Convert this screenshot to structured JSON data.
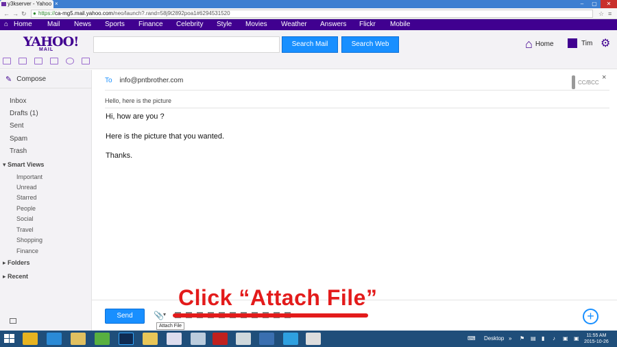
{
  "browser": {
    "tab_title": "y3kserver - Yahoo M",
    "url_prefix": "https://",
    "url_host": "ca-mg5.mail.yahoo.com",
    "url_path": "/neo/launch?.rand=58j9t2892poa1#6294531520"
  },
  "yahoo_nav": {
    "items": [
      "Home",
      "Mail",
      "News",
      "Sports",
      "Finance",
      "Celebrity",
      "Style",
      "Movies",
      "Weather",
      "Answers",
      "Flickr",
      "Mobile"
    ]
  },
  "header": {
    "logo": "YAHOO!",
    "logo_sub": "MAIL",
    "search_placeholder": "",
    "search_mail_label": "Search Mail",
    "search_web_label": "Search Web",
    "home_label": "Home",
    "user_label": "Tim"
  },
  "sidebar": {
    "compose_label": "Compose",
    "folders": [
      "Inbox",
      "Drafts (1)",
      "Sent",
      "Spam",
      "Trash"
    ],
    "smart_views_label": "Smart Views",
    "smart_views": [
      "Important",
      "Unread",
      "Starred",
      "People",
      "Social",
      "Travel",
      "Shopping",
      "Finance"
    ],
    "folders_label": "Folders",
    "recent_label": "Recent"
  },
  "compose": {
    "to_label": "To",
    "to_value": "info@pntbrother.com",
    "cc_label": "CC/BCC",
    "close_label": "×",
    "subject": "Hello, here is the picture",
    "body": [
      "Hi, how are you ?",
      "Here is the picture that you wanted.",
      "Thanks."
    ],
    "send_label": "Send",
    "attach_tooltip": "Attach File"
  },
  "annotation": {
    "text": "Click “Attach File”"
  },
  "taskbar": {
    "desktop_label": "Desktop",
    "time": "11:55 AM",
    "date": "2015-10-26"
  },
  "colors": {
    "yahoo_purple": "#400090",
    "accent_blue": "#188fff",
    "annotation_red": "#e31b1b"
  }
}
